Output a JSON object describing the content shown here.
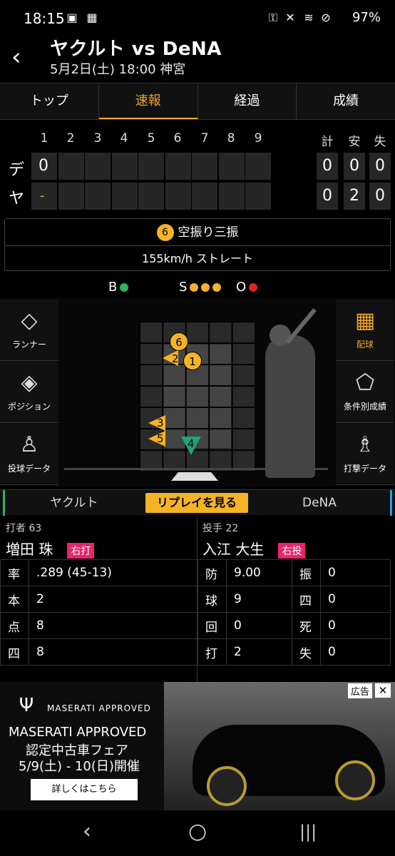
{
  "status": {
    "time": "18:15",
    "battery": "97%"
  },
  "header": {
    "title": "ヤクルト vs DeNA",
    "subtitle": "5月2日(土) 18:00 神宮",
    "back_icon": "chevron-left-icon"
  },
  "tabs": [
    {
      "label": "トップ"
    },
    {
      "label": "速報"
    },
    {
      "label": "経過"
    },
    {
      "label": "成績"
    }
  ],
  "scoreboard": {
    "innings": [
      "1",
      "2",
      "3",
      "4",
      "5",
      "6",
      "7",
      "8",
      "9"
    ],
    "totals_headers": [
      "計",
      "安",
      "失"
    ],
    "teams": [
      {
        "abbr": "デ",
        "first_inning": "0",
        "totals": [
          "0",
          "0",
          "0"
        ]
      },
      {
        "abbr": "ヤ",
        "first_inning": "-",
        "totals": [
          "0",
          "2",
          "0"
        ]
      }
    ]
  },
  "play": {
    "pitch_no": "6",
    "result": "空振り三振",
    "detail": "155km/h ストレート"
  },
  "count": {
    "b_label": "B",
    "s_label": "S",
    "o_label": "O",
    "balls": 1,
    "strikes": 3,
    "outs": 1,
    "colors": {
      "ball": "#2db35d",
      "strike": "#f5b325",
      "out": "#e52222"
    }
  },
  "left_buttons": [
    {
      "label": "ランナー"
    },
    {
      "label": "ポジション"
    },
    {
      "label": "投球データ"
    }
  ],
  "right_buttons": [
    {
      "label": "配球"
    },
    {
      "label": "条件別成績"
    },
    {
      "label": "打撃データ"
    }
  ],
  "pitches": [
    "6",
    "2",
    "1",
    "3",
    "5",
    "4"
  ],
  "replay": {
    "left_team": "ヤクルト",
    "button": "リプレイを見る",
    "right_team": "DeNA"
  },
  "batter": {
    "role": "打者 63",
    "name": "増田 珠",
    "hand": "右打",
    "stats": [
      {
        "k": "率",
        "v": ".289 (45-13)"
      },
      {
        "k": "本",
        "v": "2"
      },
      {
        "k": "点",
        "v": "8"
      },
      {
        "k": "四",
        "v": "8"
      }
    ]
  },
  "pitcher": {
    "role": "投手 22",
    "name": "入江 大生",
    "hand": "右投",
    "stats_left": [
      {
        "k": "防",
        "v": "9.00"
      },
      {
        "k": "球",
        "v": "9"
      },
      {
        "k": "回",
        "v": "0"
      },
      {
        "k": "打",
        "v": "2"
      }
    ],
    "stats_right": [
      {
        "k": "振",
        "v": "0"
      },
      {
        "k": "四",
        "v": "0"
      },
      {
        "k": "死",
        "v": "0"
      },
      {
        "k": "失",
        "v": "0"
      }
    ]
  },
  "ad": {
    "brand": "MASERATI APPROVED",
    "headline": "MASERATI APPROVED",
    "line2": "認定中古車フェア",
    "line3": "5/9(土) - 10(日)開催",
    "cta": "詳しくはこちら",
    "ad_label": "広告"
  }
}
